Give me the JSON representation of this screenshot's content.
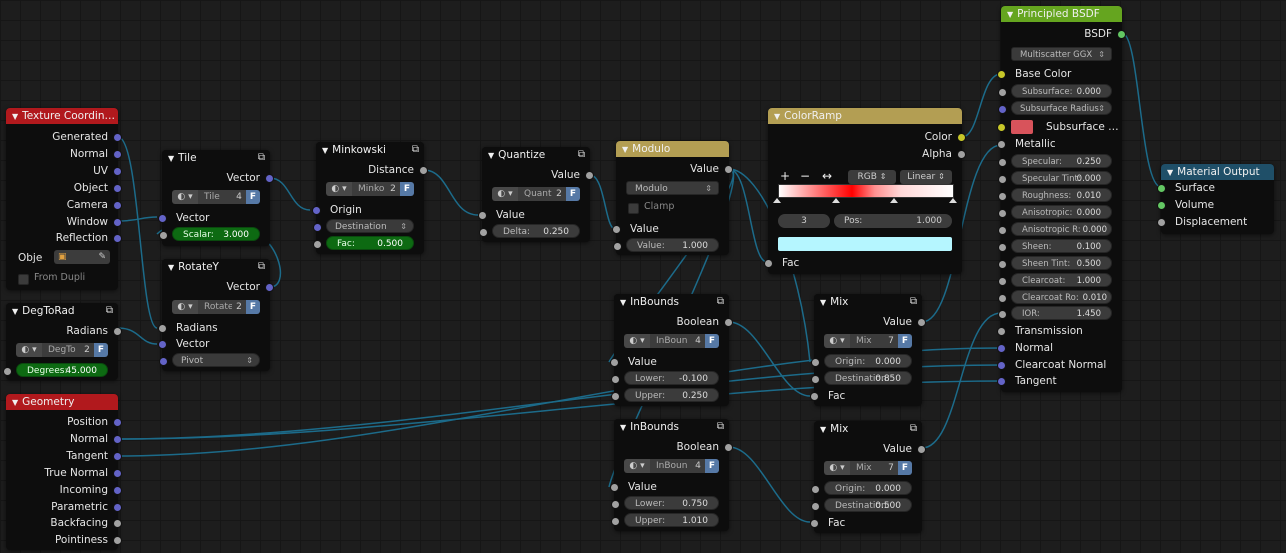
{
  "colors": {
    "tex_header": "#b1191d",
    "geom_header": "#b1191d",
    "conv_header": "#0d0d0d",
    "modulo_header": "#b39e53",
    "ramp_header": "#b39e53",
    "bsdf_header": "#65a51f",
    "output_header": "#1f4f68",
    "wire": "#1c6b8a"
  },
  "tex": {
    "title": "Texture Coordin…",
    "outputs": [
      "Generated",
      "Normal",
      "UV",
      "Object",
      "Camera",
      "Window",
      "Reflection"
    ],
    "obj_label": "Obje",
    "from_dupli": "From Dupli"
  },
  "tile": {
    "title": "Tile",
    "out": "Vector",
    "dbname": "Tile",
    "dbnum": "4",
    "dbf": "F",
    "in": "Vector",
    "scalar_k": "Scalar:",
    "scalar_v": "3.000"
  },
  "rotatey": {
    "title": "RotateY",
    "out": "Vector",
    "dbname": "Rotate",
    "dbnum": "2",
    "dbf": "F",
    "in1": "Radians",
    "in2": "Vector",
    "pivot": "Pivot"
  },
  "degtorad": {
    "title": "DegToRad",
    "out": "Radians",
    "dbname": "DegTo",
    "dbnum": "2",
    "dbf": "F",
    "deg_k": "Degrees:",
    "deg_v": "45.000"
  },
  "geometry": {
    "title": "Geometry",
    "outputs": [
      "Position",
      "Normal",
      "Tangent",
      "True Normal",
      "Incoming",
      "Parametric",
      "Backfacing",
      "Pointiness"
    ]
  },
  "minkowski": {
    "title": "Minkowski",
    "out": "Distance",
    "dbname": "Minko",
    "dbnum": "2",
    "dbf": "F",
    "in": "Origin",
    "dest": "Destination",
    "fac_k": "Fac:",
    "fac_v": "0.500"
  },
  "quantize": {
    "title": "Quantize",
    "out": "Value",
    "dbname": "Quanti",
    "dbnum": "2",
    "dbf": "F",
    "in": "Value",
    "delta_k": "Delta:",
    "delta_v": "0.250"
  },
  "modulo": {
    "title": "Modulo",
    "out": "Value",
    "mode": "Modulo",
    "clamp": "Clamp",
    "in": "Value",
    "val_k": "Value:",
    "val_v": "1.000"
  },
  "ramp": {
    "title": "ColorRamp",
    "out1": "Color",
    "out2": "Alpha",
    "plus": "+",
    "minus": "−",
    "flip": "↔",
    "mode": "RGB",
    "interp": "Linear",
    "idx": "3",
    "pos_k": "Pos:",
    "pos_v": "1.000",
    "in": "Fac"
  },
  "inb1": {
    "title": "InBounds",
    "out": "Boolean",
    "dbname": "InBoun",
    "dbnum": "4",
    "dbf": "F",
    "in": "Value",
    "lower_k": "Lower:",
    "lower_v": "-0.100",
    "upper_k": "Upper:",
    "upper_v": "0.250"
  },
  "inb2": {
    "title": "InBounds",
    "out": "Boolean",
    "dbname": "InBoun",
    "dbnum": "4",
    "dbf": "F",
    "in": "Value",
    "lower_k": "Lower:",
    "lower_v": "0.750",
    "upper_k": "Upper:",
    "upper_v": "1.010"
  },
  "mix1": {
    "title": "Mix",
    "out": "Value",
    "dbname": "Mix",
    "dbnum": "7",
    "dbf": "F",
    "origin_k": "Origin:",
    "origin_v": "0.000",
    "dest_k": "Destination:",
    "dest_v": "0.850",
    "in": "Fac"
  },
  "mix2": {
    "title": "Mix",
    "out": "Value",
    "dbname": "Mix",
    "dbnum": "7",
    "dbf": "F",
    "origin_k": "Origin:",
    "origin_v": "0.000",
    "dest_k": "Destination:",
    "dest_v": "0.500",
    "in": "Fac"
  },
  "bsdf": {
    "title": "Principled BSDF",
    "out": "BSDF",
    "dist": "Multiscatter GGX",
    "base": "Base Color",
    "fields": [
      [
        "Subsurface:",
        "0.000"
      ],
      [
        "Subsurface Radius",
        ""
      ]
    ],
    "sscolor": "Subsurface …",
    "metallic": "Metallic",
    "fields2": [
      [
        "Specular:",
        "0.250"
      ],
      [
        "Specular Tint:",
        "0.000"
      ],
      [
        "Roughness:",
        "0.010"
      ],
      [
        "Anisotropic:",
        "0.000"
      ],
      [
        "Anisotropic R:",
        "0.000"
      ],
      [
        "Sheen:",
        "0.100"
      ],
      [
        "Sheen Tint:",
        "0.500"
      ],
      [
        "Clearcoat:",
        "1.000"
      ],
      [
        "Clearcoat Ro:",
        "0.010"
      ],
      [
        "IOR:",
        "1.450"
      ]
    ],
    "inputs": [
      "Transmission",
      "Normal",
      "Clearcoat Normal",
      "Tangent"
    ]
  },
  "output": {
    "title": "Material Output",
    "inputs": [
      "Surface",
      "Volume",
      "Displacement"
    ]
  }
}
